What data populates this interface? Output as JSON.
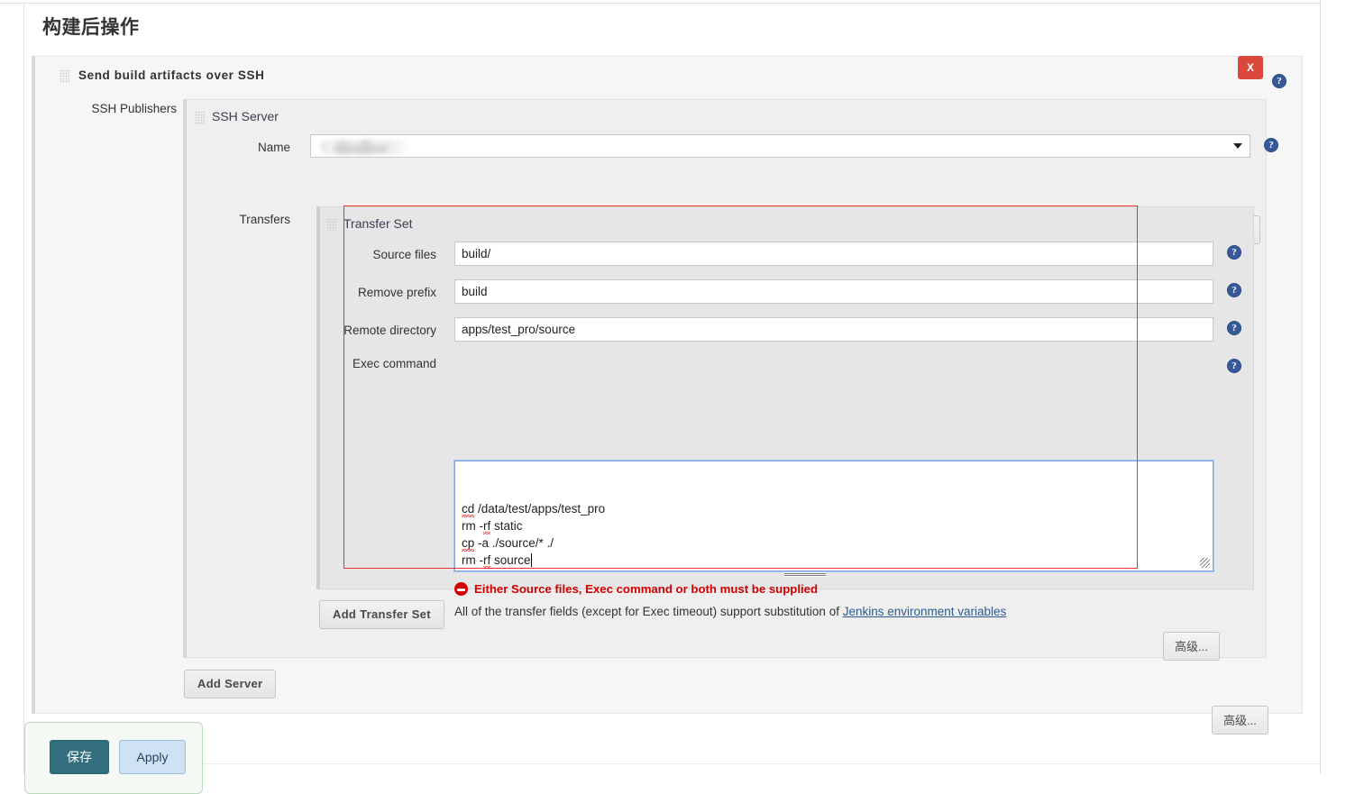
{
  "page": {
    "title": "构建后操作"
  },
  "publisher": {
    "title": "Send build artifacts over SSH",
    "close_label": "X",
    "help_label": "?",
    "publishers_label": "SSH Publishers"
  },
  "server": {
    "title": "SSH Server",
    "name_label": "Name",
    "name_value": "",
    "name_blurred": true,
    "advanced_label": "高级...",
    "transfers_label": "Transfers",
    "add_server_label": "Add Server"
  },
  "transfer_set": {
    "title": "Transfer Set",
    "fields": [
      {
        "label": "Source files",
        "value": "build/"
      },
      {
        "label": "Remove prefix",
        "value": "build"
      },
      {
        "label": "Remote directory",
        "value": "apps/test_pro/source"
      }
    ],
    "exec_label": "Exec command",
    "exec_lines": [
      {
        "misspelled": "cd",
        "rest": " /data/test/apps/test_pro"
      },
      {
        "pre": "rm -",
        "misspelled": "rf",
        "rest": " static"
      },
      {
        "misspelled": "cp",
        "rest": " -a ./source/* ./"
      },
      {
        "pre": "rm -",
        "misspelled": "rf",
        "rest": " source",
        "caret": true
      }
    ],
    "error_message": "Either Source files, Exec command or both must be supplied",
    "hint_prefix": "All of the transfer fields (except for Exec timeout) support substitution of ",
    "hint_link": "Jenkins environment variables",
    "advanced_label": "高级...",
    "add_transfer_label": "Add Transfer Set"
  },
  "footer": {
    "advanced_label": "高级...",
    "save_label": "保存",
    "apply_label": "Apply"
  },
  "colors": {
    "accent_red": "#d9483b",
    "annotation_red": "#e8372a",
    "error_red": "#cf0000",
    "help_blue": "#36599b",
    "save_teal": "#336e7e",
    "apply_blue": "#cfe2f5"
  }
}
